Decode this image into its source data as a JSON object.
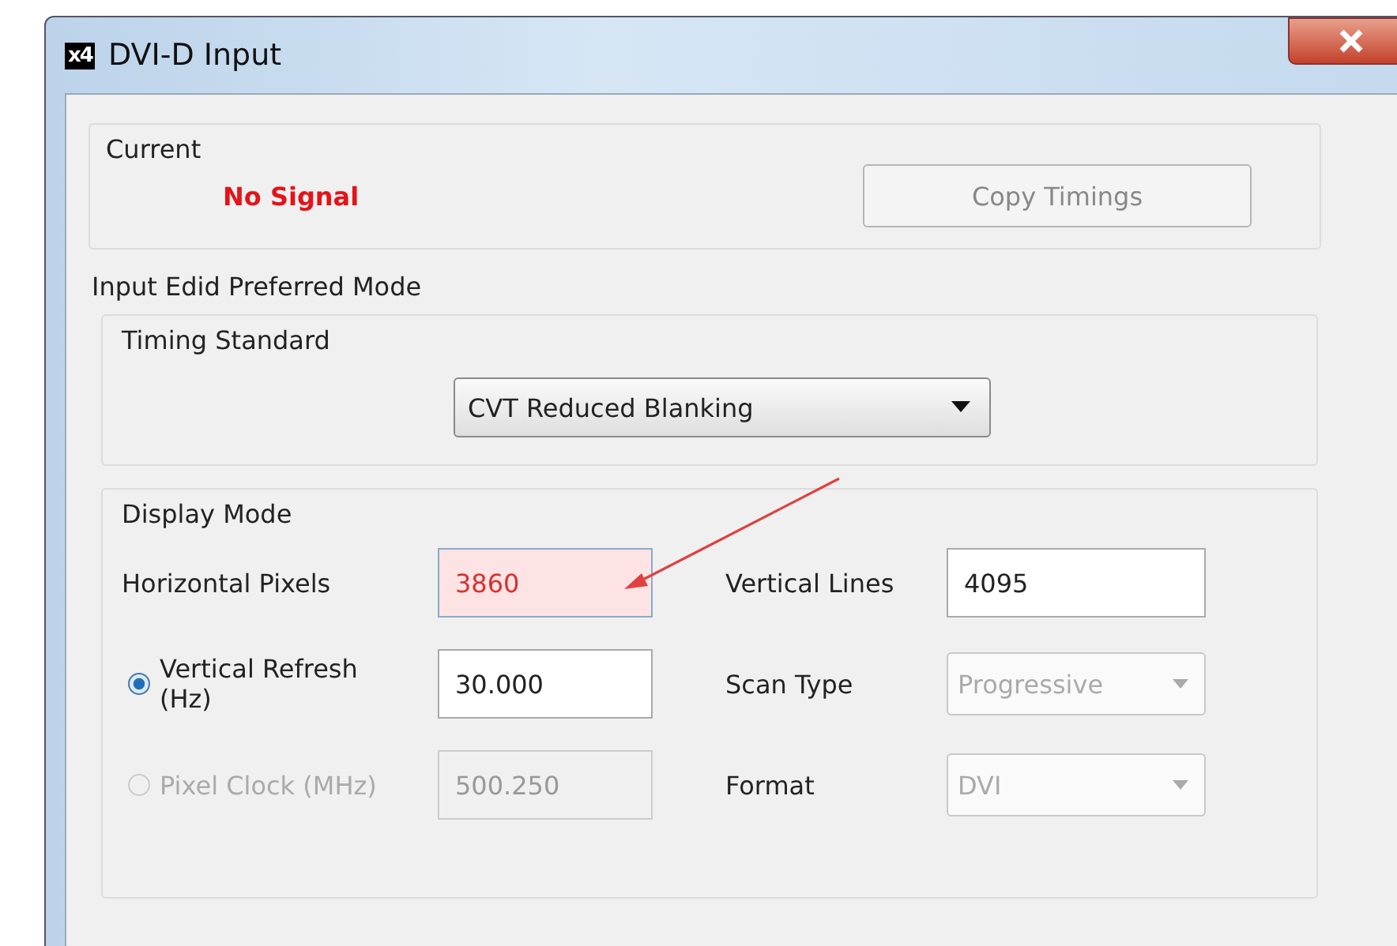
{
  "window": {
    "title": "DVI-D Input",
    "app_badge": "x4"
  },
  "current": {
    "label": "Current",
    "status": "No Signal",
    "copy_button": {
      "label": "Copy Timings",
      "disabled": true
    }
  },
  "edid": {
    "label": "Input Edid Preferred Mode",
    "timing_standard": {
      "label": "Timing Standard",
      "value": "CVT Reduced Blanking"
    },
    "display_mode": {
      "label": "Display Mode",
      "rows": [
        {
          "left": {
            "kind": "text",
            "label": "Horizontal Pixels",
            "value": "3860",
            "highlighted": true,
            "disabled": false
          },
          "right": {
            "kind": "text",
            "label": "Vertical Lines",
            "value": "4095",
            "disabled": false
          }
        },
        {
          "left": {
            "kind": "radio",
            "label": "Vertical Refresh (Hz)",
            "value": "30.000",
            "selected": true,
            "disabled": false
          },
          "right": {
            "kind": "select",
            "label": "Scan Type",
            "value": "Progressive",
            "disabled": true
          }
        },
        {
          "left": {
            "kind": "radio",
            "label": "Pixel Clock (MHz)",
            "value": "500.250",
            "selected": false,
            "disabled": true
          },
          "right": {
            "kind": "select",
            "label": "Format",
            "value": "DVI",
            "disabled": true
          }
        }
      ]
    }
  }
}
